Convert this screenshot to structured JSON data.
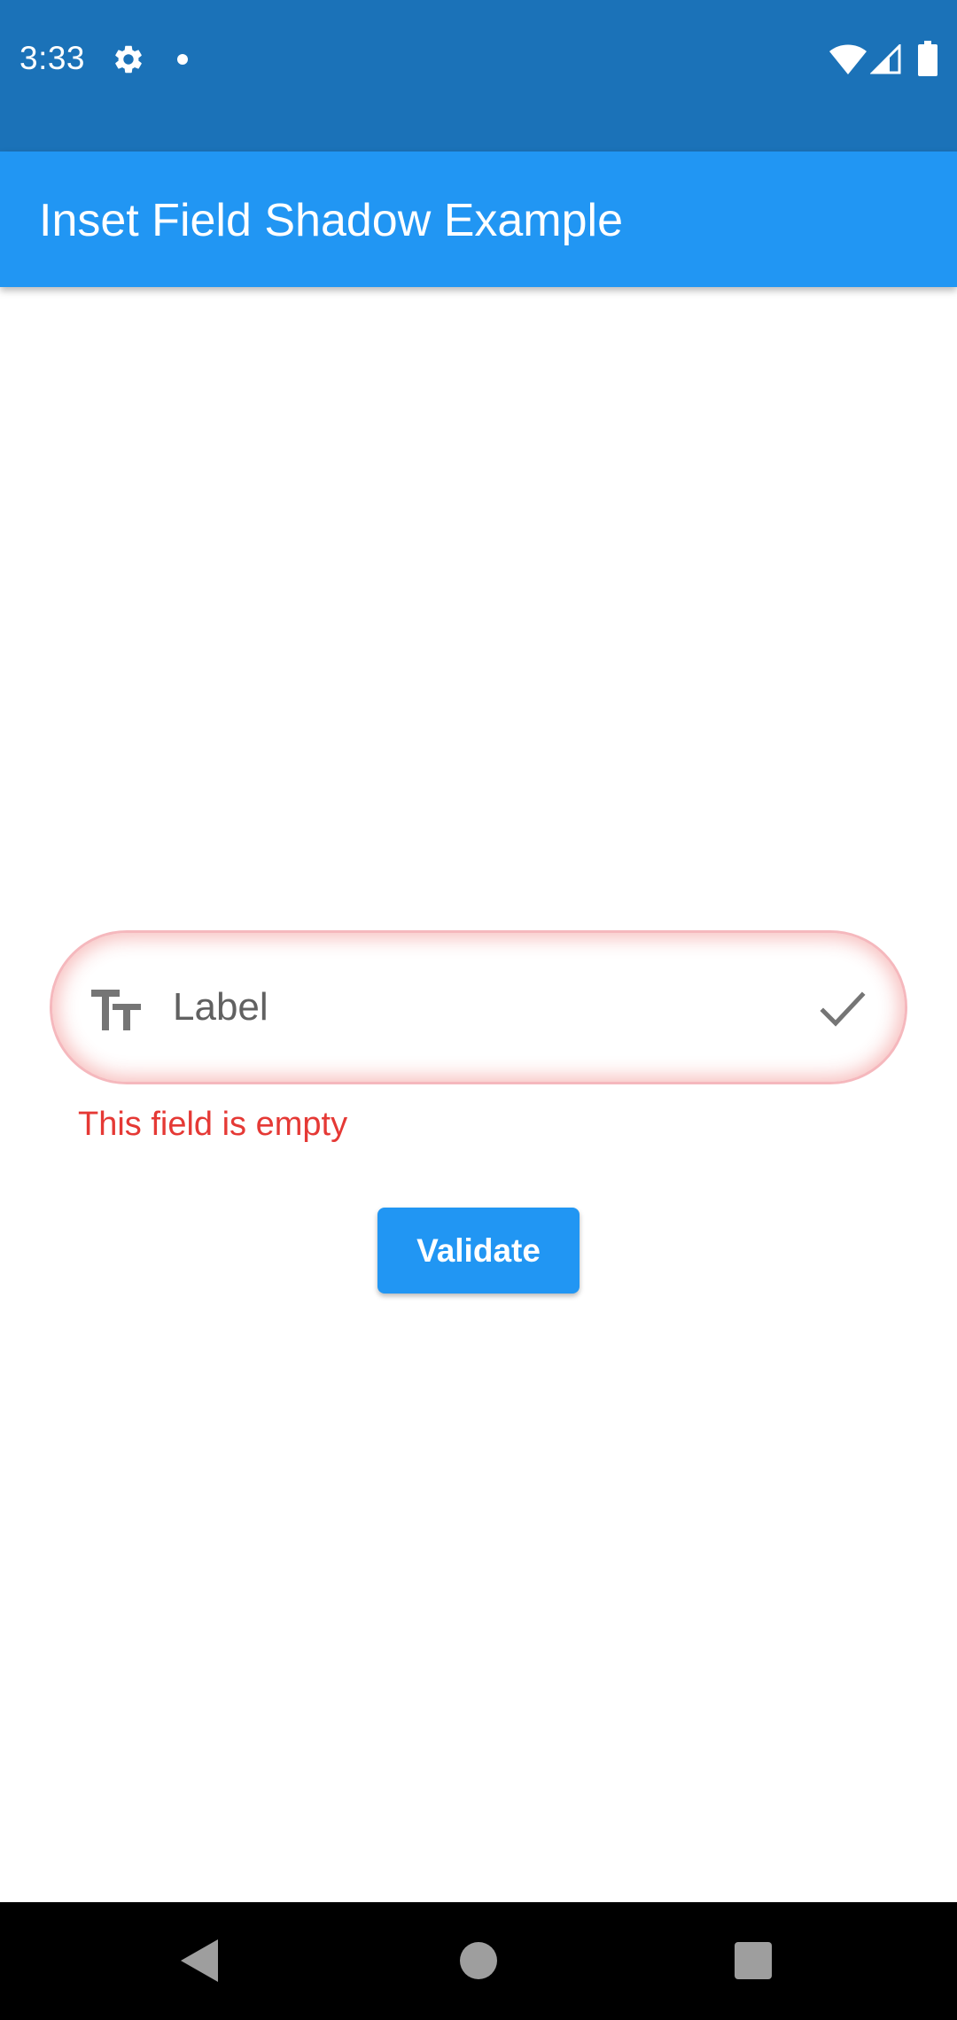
{
  "status_bar": {
    "time": "3:33",
    "icons": [
      "gear-icon",
      "notification-dot-icon",
      "wifi-icon",
      "cell-signal-icon",
      "battery-icon"
    ]
  },
  "app_bar": {
    "title": "Inset Field Shadow Example",
    "color": "#2196f3"
  },
  "form": {
    "field": {
      "leading_icon": "text-fields-icon",
      "placeholder": "Label",
      "value": "",
      "trailing_icon": "check-icon",
      "error_text": "This field is empty",
      "error_color": "#e53935"
    },
    "validate_button": {
      "label": "Validate",
      "color": "#2196f3"
    }
  },
  "nav_bar": {
    "icons": [
      "back-icon",
      "home-icon",
      "recents-icon"
    ]
  }
}
